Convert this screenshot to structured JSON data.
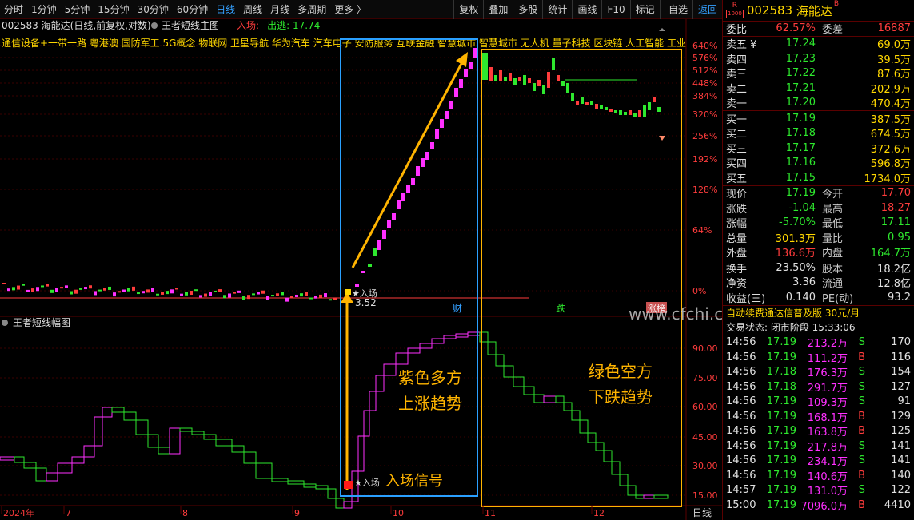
{
  "toolbar": {
    "left": [
      "分时",
      "1分钟",
      "5分钟",
      "15分钟",
      "30分钟",
      "60分钟",
      "日线",
      "周线",
      "月线",
      "多周期",
      "更多 〉"
    ],
    "active": "日线",
    "right": [
      "复权",
      "叠加",
      "多股",
      "统计",
      "画线",
      "F10",
      "标记",
      "-自选",
      "返回"
    ]
  },
  "title": {
    "code": "002583",
    "name": "海能达",
    "mode": "(日线,前复权,对数)",
    "indicator": "王者短线主图",
    "entry_label": "入场:",
    "exit_label": "- 出逃: 17.74"
  },
  "concepts": "通信设备+一带一路 粤港澳 国防军工 5G概念 物联网 卫星导航 华为汽车 汽车电子 安防服务 互联金融 智慧城市 智慧城市 无人机 量子科技 区块链 人工智能 工业",
  "lower_title": "王者短线幅图",
  "main_axis": [
    "640%",
    "576%",
    "512%",
    "448%",
    "384%",
    "320%",
    "256%",
    "192%",
    "128%",
    "64%",
    "0%"
  ],
  "lower_axis": [
    "90.00",
    "75.00",
    "60.00",
    "45.00",
    "30.00",
    "15.00"
  ],
  "dates": [
    "2024年",
    "7",
    "8",
    "9",
    "10",
    "11",
    "12"
  ],
  "period_label": "日线",
  "annotations": {
    "entry_tag": "入场",
    "entry_price": "3.52",
    "lower_entry_tag": "入场",
    "lower_entry_signal": "入场信号",
    "purple_text1": "紫色多方",
    "purple_text2": "上涨趋势",
    "green_text1": "绿色空方",
    "green_text2": "下跌趋势",
    "cai": "财",
    "die": "跌",
    "zhang": "涨榜",
    "watermark": "www.cfchi.com"
  },
  "sidebar": {
    "badge": "R",
    "badge_sub": "1000",
    "code": "002583",
    "name": "海能达",
    "flag": "B",
    "commission": {
      "label1": "委比",
      "val1": "62.57%",
      "label2": "委差",
      "val2": "16887"
    },
    "asks": [
      {
        "label": "卖五 ¥",
        "price": "17.24",
        "vol": "69.0万"
      },
      {
        "label": "卖四",
        "price": "17.23",
        "vol": "39.5万"
      },
      {
        "label": "卖三",
        "price": "17.22",
        "vol": "87.6万"
      },
      {
        "label": "卖二",
        "price": "17.21",
        "vol": "202.9万"
      },
      {
        "label": "卖一",
        "price": "17.20",
        "vol": "470.4万"
      }
    ],
    "bids": [
      {
        "label": "买一",
        "price": "17.19",
        "vol": "387.5万"
      },
      {
        "label": "买二",
        "price": "17.18",
        "vol": "674.5万"
      },
      {
        "label": "买三",
        "price": "17.17",
        "vol": "372.6万"
      },
      {
        "label": "买四",
        "price": "17.16",
        "vol": "596.8万"
      },
      {
        "label": "买五",
        "price": "17.15",
        "vol": "1734.0万"
      }
    ],
    "quote": [
      {
        "l1": "现价",
        "v1": "17.19",
        "c1": "green",
        "l2": "今开",
        "v2": "17.70",
        "c2": "red"
      },
      {
        "l1": "涨跌",
        "v1": "-1.04",
        "c1": "green",
        "l2": "最高",
        "v2": "18.27",
        "c2": "red"
      },
      {
        "l1": "涨幅",
        "v1": "-5.70%",
        "c1": "green",
        "l2": "最低",
        "v2": "17.11",
        "c2": "green"
      },
      {
        "l1": "总量",
        "v1": "301.3万",
        "c1": "yellow",
        "l2": "量比",
        "v2": "0.95",
        "c2": "green"
      },
      {
        "l1": "外盘",
        "v1": "136.6万",
        "c1": "red",
        "l2": "内盘",
        "v2": "164.7万",
        "c2": "green"
      }
    ],
    "fund": [
      {
        "l1": "换手",
        "v1": "23.50%",
        "l2": "股本",
        "v2": "18.2亿"
      },
      {
        "l1": "净资",
        "v1": "3.36",
        "l2": "流通",
        "v2": "12.8亿"
      },
      {
        "l1": "收益(三)",
        "v1": "0.140",
        "l2": "PE(动)",
        "v2": "93.2"
      }
    ],
    "promo": "自动续费通达信普及版  30元/月",
    "status": "交易状态: 闭市阶段 15:33:06",
    "ticks": [
      {
        "t": "14:56",
        "p": "17.19",
        "v": "213.2万",
        "s": "S",
        "n": "170"
      },
      {
        "t": "14:56",
        "p": "17.19",
        "v": "111.2万",
        "s": "B",
        "n": "116"
      },
      {
        "t": "14:56",
        "p": "17.18",
        "v": "176.3万",
        "s": "S",
        "n": "154"
      },
      {
        "t": "14:56",
        "p": "17.18",
        "v": "291.7万",
        "s": "S",
        "n": "127"
      },
      {
        "t": "14:56",
        "p": "17.19",
        "v": "109.3万",
        "s": "S",
        "n": "91"
      },
      {
        "t": "14:56",
        "p": "17.19",
        "v": "168.1万",
        "s": "B",
        "n": "129"
      },
      {
        "t": "14:56",
        "p": "17.19",
        "v": "163.8万",
        "s": "B",
        "n": "125"
      },
      {
        "t": "14:56",
        "p": "17.19",
        "v": "217.8万",
        "s": "S",
        "n": "141"
      },
      {
        "t": "14:56",
        "p": "17.19",
        "v": "234.1万",
        "s": "S",
        "n": "141"
      },
      {
        "t": "14:56",
        "p": "17.19",
        "v": "140.6万",
        "s": "B",
        "n": "140"
      },
      {
        "t": "14:57",
        "p": "17.19",
        "v": "131.0万",
        "s": "S",
        "n": "122"
      },
      {
        "t": "15:00",
        "p": "17.19",
        "v": "7096.0万",
        "s": "B",
        "n": "4410"
      }
    ]
  },
  "colors": {
    "up": "#ff30ff",
    "down": "#2ee82e",
    "red": "#ff3c3c",
    "blue_box": "#2aa0ff",
    "orange_box": "#ffb400",
    "arrow": "#ffb400"
  }
}
